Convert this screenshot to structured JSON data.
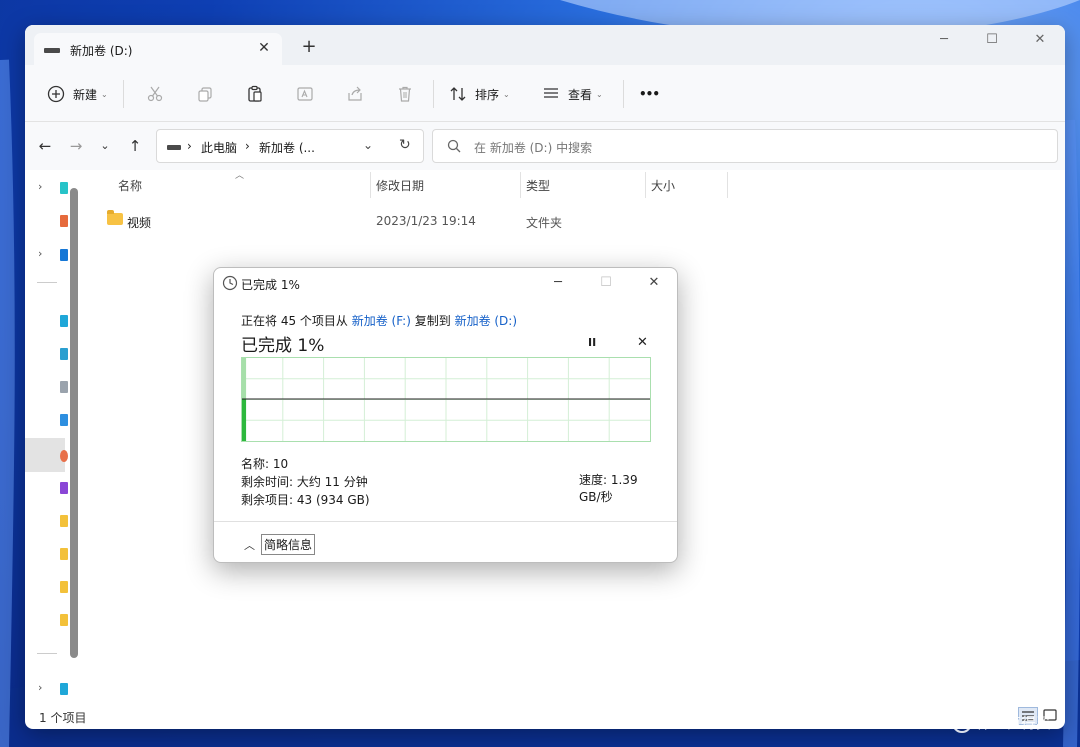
{
  "explorer": {
    "tab_title": "新加卷 (D:)",
    "new_tab_label": "+",
    "toolbar": {
      "new_label": "新建",
      "sort_label": "排序",
      "view_label": "查看",
      "more_label": "•••"
    },
    "address": {
      "breadcrumb": [
        "此电脑",
        "新加卷 (..."
      ],
      "search_placeholder": "在 新加卷 (D:) 中搜索"
    },
    "columns": [
      "名称",
      "修改日期",
      "类型",
      "大小"
    ],
    "files": [
      {
        "name": "视频",
        "modified": "2023/1/23 19:14",
        "type": "文件夹",
        "size": ""
      }
    ],
    "status": "1 个项目"
  },
  "dialog": {
    "title": "已完成 1%",
    "line_prefix": "正在将 45 个项目从 ",
    "source": "新加卷 (F:)",
    "line_middle": " 复制到 ",
    "dest": "新加卷 (D:)",
    "percent_heading": "已完成 1%",
    "progress_percent": 1,
    "speed": "速度: 1.39 GB/秒",
    "name_line": "名称: 10",
    "time_line": "剩余时间: 大约 11 分钟",
    "items_line": "剩余项目: 43 (934 GB)",
    "less_info_label": "简略信息"
  },
  "watermark": {
    "logo": "值",
    "text": "什么值得买"
  },
  "colors": {
    "link": "#1560c8",
    "progress_fill": "#2db83d",
    "graph_grid": "#d4efd6",
    "folder": "#f7c244"
  }
}
